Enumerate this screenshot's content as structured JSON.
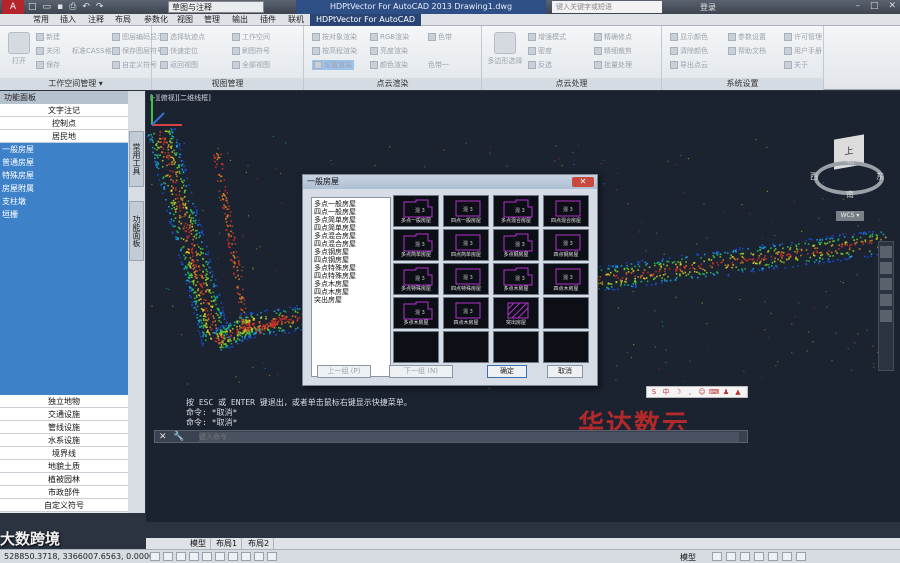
{
  "title_bar": {
    "workspace": "草图与注释",
    "app_title": "HDPtVector For AutoCAD 2013    Drawing1.dwg",
    "search_placeholder": "键入关键字或短语",
    "login": "登录"
  },
  "menu_tabs": [
    "常用",
    "插入",
    "注释",
    "布局",
    "参数化",
    "视图",
    "管理",
    "输出",
    "插件",
    "联机",
    "HDPtVector For AutoCAD"
  ],
  "ribbon": {
    "panels": [
      {
        "title": "工作空间管理 ▾",
        "big": [
          "打开"
        ],
        "items": [
          "新建",
          "关闭",
          "保存",
          "标准CASS格式",
          "添加",
          "保存图层符号",
          "图层编码显示",
          "自定义符号"
        ]
      },
      {
        "title": "视图管理",
        "items": [
          "选择轨迹点",
          "快速定位",
          "返回视图",
          "工作空间",
          "刷图符号",
          "全部视图"
        ]
      },
      {
        "title": "点云渲染",
        "items": [
          "按对象渲染",
          "按高程渲染",
          "亮度渲染",
          "RGB渲染",
          "颜色渲染",
          "色带",
          "设置渲染",
          "色带一"
        ]
      },
      {
        "title": "点云处理",
        "big": [
          "多边形选择"
        ],
        "items": [
          "增强模式",
          "密度",
          "反选",
          "精确修点",
          "精细裁剪",
          "批量处理",
          "断面查看"
        ]
      },
      {
        "title": "系统设置",
        "items": [
          "显示颜色",
          "清除颜色",
          "导出点云",
          "参数设置",
          "帮助文档",
          "许可管理",
          "用户手册",
          "关于"
        ]
      }
    ]
  },
  "palette": {
    "header": "功能面板",
    "top_items": [
      "文字注记",
      "控制点",
      "居民地"
    ],
    "sub_items": [
      "一般房屋",
      "普通房屋",
      "特殊房屋",
      "房屋附属",
      "支柱墩",
      "垣栅"
    ],
    "bottom_items": [
      "独立地物",
      "交通设施",
      "管线设施",
      "水系设施",
      "境界线",
      "地貌土质",
      "植被园林",
      "市政部件",
      "自定义符号"
    ],
    "side_tabs": [
      "常用工具",
      "功能面板"
    ]
  },
  "viewport": {
    "label": "[-][俯视][二维线框]",
    "viewcube_face": "上",
    "viewcube_dirs": {
      "n": "北",
      "e": "东",
      "s": "南",
      "w": "西"
    },
    "wcs": "WCS ▾"
  },
  "dialog": {
    "title": "一般房屋",
    "list": [
      "多点一般房屋",
      "四点一般房屋",
      "多点简单房屋",
      "四点简单房屋",
      "多点混合房屋",
      "四点混合房屋",
      "多点钢房屋",
      "四点钢房屋",
      "多点特殊房屋",
      "四点特殊房屋",
      "多点木房屋",
      "四点木房屋",
      "突出房屋"
    ],
    "cells": [
      {
        "caption": "多点一般房屋",
        "kind": "house"
      },
      {
        "caption": "四点一般房屋",
        "kind": "rect"
      },
      {
        "caption": "多点混合房屋",
        "kind": "house"
      },
      {
        "caption": "四点混合房屋",
        "kind": "rect"
      },
      {
        "caption": "多点简单房屋",
        "kind": "house"
      },
      {
        "caption": "四点简单房屋",
        "kind": "rect"
      },
      {
        "caption": "多点钢房屋",
        "kind": "house"
      },
      {
        "caption": "四点钢房屋",
        "kind": "rect"
      },
      {
        "caption": "多点特殊房屋",
        "kind": "house"
      },
      {
        "caption": "四点特殊房屋",
        "kind": "rect"
      },
      {
        "caption": "多点木房屋",
        "kind": "house"
      },
      {
        "caption": "四点木房屋",
        "kind": "rect"
      },
      {
        "caption": "多点木房屋",
        "kind": "house"
      },
      {
        "caption": "四点木房屋",
        "kind": "rect"
      },
      {
        "caption": "突出房屋",
        "kind": "hatch"
      },
      {
        "caption": "",
        "kind": "empty"
      },
      {
        "caption": "",
        "kind": "empty"
      },
      {
        "caption": "",
        "kind": "empty"
      },
      {
        "caption": "",
        "kind": "empty"
      },
      {
        "caption": "",
        "kind": "empty"
      }
    ],
    "prev_button": "上一组 (P)",
    "next_button": "下一组 (N)",
    "ok_button": "确定",
    "cancel_button": "取消"
  },
  "command": {
    "history": [
      "按 ESC 或 ENTER 键退出，或者单击鼠标右键显示快捷菜单。",
      "命令: *取消*",
      "命令: *取消*"
    ],
    "input_placeholder": "键入命令"
  },
  "layout_tabs": [
    "模型",
    "布局1",
    "布局2"
  ],
  "status": {
    "coords": "528850.3718, 3366007.6563, 0.0000",
    "mode": "模型"
  },
  "watermarks": {
    "brand_right": "华达数云",
    "brand_left": "大数跨境"
  },
  "colors": {
    "ribbon_active_tab": "#2a4575",
    "palette_selection": "#3d82c8",
    "canvas_bg": "#1b2230",
    "house_magenta": "#b030c8"
  }
}
